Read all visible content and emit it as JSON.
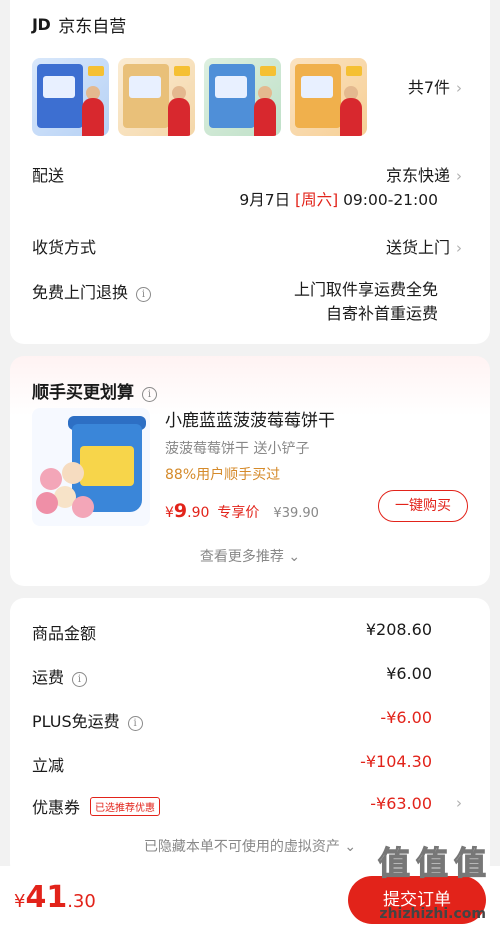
{
  "order": {
    "shop_logo": "JD",
    "shop_name": "京东自营",
    "items_count": "共7件",
    "delivery_label": "配送",
    "delivery_value": "京东快递",
    "delivery_date": "9月7日",
    "delivery_day": "[周六]",
    "delivery_time": "09:00-21:00",
    "receive_label": "收货方式",
    "receive_value": "送货上门",
    "return_label": "免费上门退换",
    "return_line1": "上门取件享运费全免",
    "return_line2": "自寄补首重运费"
  },
  "recommend": {
    "title": "顺手买更划算",
    "product_name": "小鹿蓝蓝菠菠莓莓饼干",
    "product_sub": "菠菠莓莓饼干 送小铲子",
    "bought_text": "88%用户顺手买过",
    "price_symbol": "¥",
    "price_int": "9",
    "price_dec": ".90",
    "price_tag": "专享价",
    "price_old": "¥39.90",
    "buy_button": "一键购买",
    "more_text": "查看更多推荐"
  },
  "summary": {
    "goods_label": "商品金额",
    "goods_value": "¥208.60",
    "freight_label": "运费",
    "freight_value": "¥6.00",
    "plus_label": "PLUS免运费",
    "plus_value": "-¥6.00",
    "discount_label": "立减",
    "discount_value": "-¥104.30",
    "coupon_label": "优惠券",
    "coupon_badge": "已选推荐优惠",
    "coupon_value": "-¥63.00",
    "hidden_note": "已隐藏本单不可使用的虚拟资产"
  },
  "footer": {
    "total_symbol": "¥",
    "total_int": "41",
    "total_dec": ".30",
    "submit_label": "提交订单"
  },
  "watermark": {
    "text": "值值值",
    "url": "zhizhizhi.com"
  },
  "icons": {
    "chevron": "chevron-right-icon",
    "info": "info-icon",
    "more": "chevron-down-icon"
  },
  "colors": {
    "accent": "#e2231a",
    "bought": "#d58a2a"
  }
}
